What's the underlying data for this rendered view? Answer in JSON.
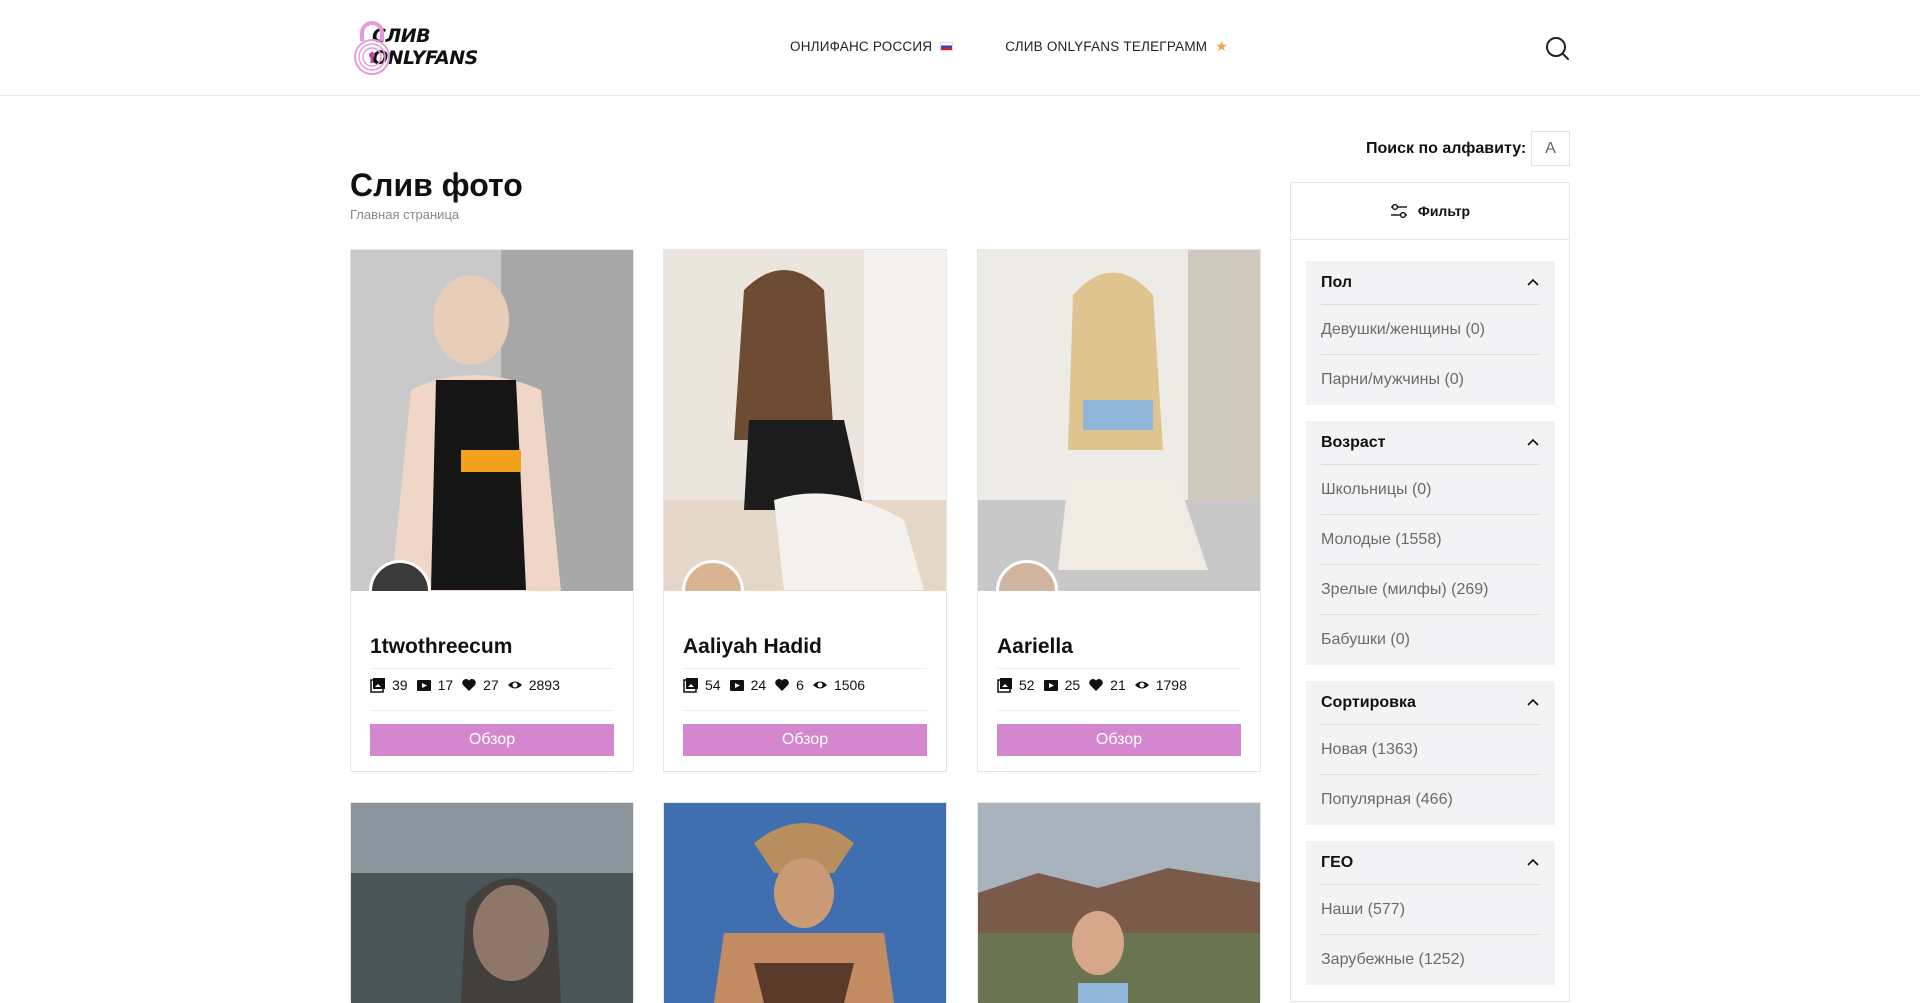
{
  "header": {
    "logo": {
      "line1": "СЛИВ",
      "line2": "ONLYFANS"
    },
    "nav": [
      {
        "label": "ОНЛИФАНС РОССИЯ",
        "icon": "russia-flag-icon"
      },
      {
        "label": "СЛИВ ONLYFANS ТЕЛЕГРАММ",
        "icon": "star-icon"
      }
    ],
    "search_icon": "search-icon"
  },
  "page": {
    "title": "Слив фото",
    "breadcrumb": "Главная страница"
  },
  "cards": [
    {
      "name": "1twothreecum",
      "photos": "39",
      "videos": "17",
      "likes": "27",
      "views": "2893",
      "button": "Обзор",
      "img_colors": [
        "#cfcfcf",
        "#8d8d8d",
        "#1a1a1a"
      ]
    },
    {
      "name": "Aaliyah Hadid",
      "photos": "54",
      "videos": "24",
      "likes": "6",
      "views": "1506",
      "button": "Обзор",
      "img_colors": [
        "#e8e2da",
        "#b88c6c",
        "#2a2a2a"
      ]
    },
    {
      "name": "Aariella",
      "photos": "52",
      "videos": "25",
      "likes": "21",
      "views": "1798",
      "button": "Обзор",
      "img_colors": [
        "#e9e6e0",
        "#d8b99a",
        "#8fb6d8"
      ]
    },
    {
      "name": "",
      "img_colors": [
        "#5c6a70",
        "#2f3a3d",
        "#d7b8a5"
      ]
    },
    {
      "name": "",
      "img_colors": [
        "#3d6fb4",
        "#c98f5e",
        "#5a3a2a"
      ]
    },
    {
      "name": "",
      "img_colors": [
        "#9aa8b4",
        "#7a5a48",
        "#5f6b4a"
      ]
    }
  ],
  "sidebar": {
    "alpha_label": "Поиск по алфавиту:",
    "alpha_value": "A",
    "filter_label": "Фильтр",
    "groups": [
      {
        "title": "Пол",
        "items": [
          "Девушки/женщины (0)",
          "Парни/мужчины (0)"
        ]
      },
      {
        "title": "Возраст",
        "items": [
          "Школьницы (0)",
          "Молодые (1558)",
          "Зрелые (милфы) (269)",
          "Бабушки (0)"
        ]
      },
      {
        "title": "Сортировка",
        "items": [
          "Новая (1363)",
          "Популярная (466)"
        ]
      },
      {
        "title": "ГЕО",
        "items": [
          "Наши (577)",
          "Зарубежные (1252)"
        ]
      }
    ]
  },
  "colors": {
    "accent": "#d487ce",
    "logo_pink": "#e59bd9"
  }
}
